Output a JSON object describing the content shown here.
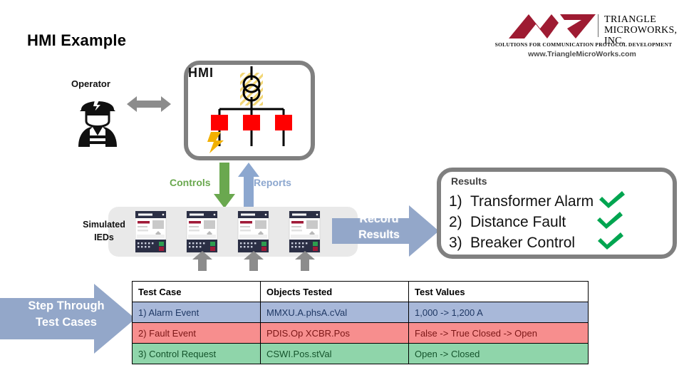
{
  "page": {
    "title": "HMI Example"
  },
  "logo": {
    "name_line1": "TRIANGLE",
    "name_line2": "MICROWORKS, INC.",
    "tagline": "SOLUTIONS FOR COMMUNICATION PROTOCOL DEVELOPMENT",
    "url": "www.TriangleMicroWorks.com",
    "mark_color": "#9e1b32"
  },
  "diagram": {
    "operator_label": "Operator",
    "hmi_label": "HMI",
    "controls_label": "Controls",
    "reports_label": "Reports",
    "controls_color": "#6aa84f",
    "reports_color": "#8ca7cf",
    "breaker_color": "#ff0000",
    "fault_color": "#f2b000",
    "transformer_hatch_color": "#f2d675"
  },
  "simulated_ieds": {
    "label_line1": "Simulated",
    "label_line2": "IEDs",
    "device_count": 4
  },
  "record": {
    "label_line1": "Record",
    "label_line2": "Results",
    "arrow_color": "#93a7c9"
  },
  "step_through": {
    "label_line1": "Step Through",
    "label_line2": "Test Cases",
    "arrow_color": "#93a7c9"
  },
  "results": {
    "title": "Results",
    "check_color": "#00a550",
    "items": [
      {
        "num": "1)",
        "text": "Transformer Alarm",
        "checked": true
      },
      {
        "num": "2)",
        "text": "Distance Fault",
        "checked": true
      },
      {
        "num": "3)",
        "text": "Breaker Control",
        "checked": true
      }
    ]
  },
  "table": {
    "headers": [
      "Test Case",
      "Objects Tested",
      "Test Values"
    ],
    "rows": [
      {
        "style": "row-alarm",
        "fill": "#a8b8d9",
        "text_color": "#1f3864",
        "cells": [
          "1) Alarm Event",
          "MMXU.A.phsA.cVal",
          "1,000 -> 1,200 A"
        ]
      },
      {
        "style": "row-fault",
        "fill": "#f78e8e",
        "text_color": "#7b1616",
        "cells": [
          "2) Fault Event",
          "PDIS.Op    XCBR.Pos",
          "False -> True    Closed -> Open"
        ]
      },
      {
        "style": "row-control",
        "fill": "#8fd5aa",
        "text_color": "#14532b",
        "cells": [
          "3) Control Request",
          "CSWI.Pos.stVal",
          "Open -> Closed"
        ]
      }
    ]
  }
}
